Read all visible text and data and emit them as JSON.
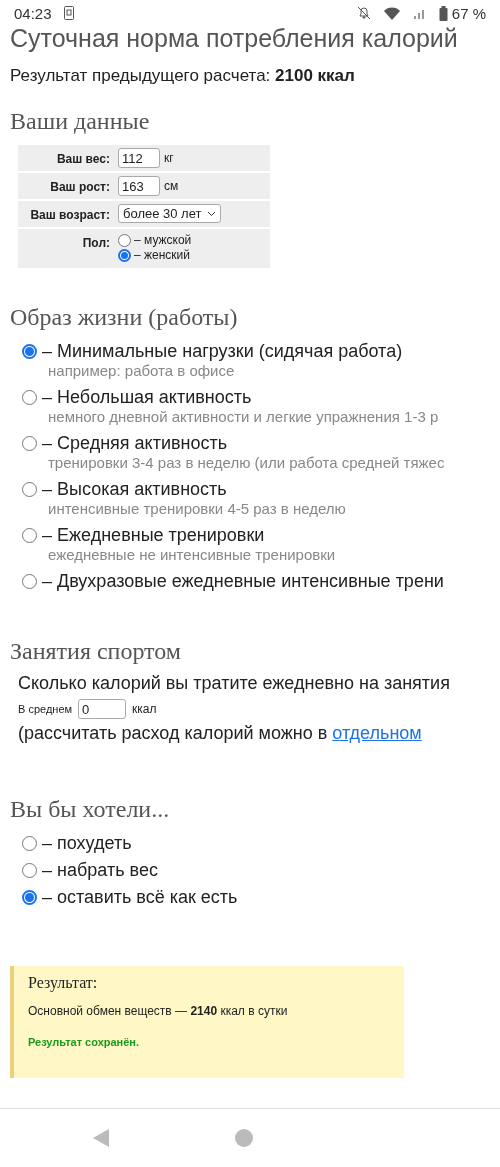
{
  "status_bar": {
    "time": "04:23",
    "battery": "67 %"
  },
  "title": "Суточная норма потребления калорий",
  "previous_result": "Результат предыдущего расчета: **2100 ккал**",
  "your_data": {
    "heading": "Ваши данные",
    "fields": [
      {
        "kind": "input",
        "label": "Ваш вес:",
        "value": "112",
        "unit": "кг"
      },
      {
        "kind": "input",
        "label": "Ваш рост:",
        "value": "163",
        "unit": "см"
      },
      {
        "kind": "select",
        "label": "Ваш возраст:",
        "value": "более 30 лет"
      },
      {
        "kind": "radio",
        "label": "Пол:",
        "options": [
          {
            "label": "– мужской",
            "selected": false
          },
          {
            "label": "– женский",
            "selected": true
          }
        ]
      }
    ]
  },
  "lifestyle": {
    "heading": "Образ жизни (работы)",
    "options": [
      {
        "label": "– Минимальные нагрузки (сидячая работа)",
        "note": "например: работа в офисе",
        "selected": true
      },
      {
        "label": "– Небольшая активность",
        "note": "немного дневной активности и легкие упражнения 1-3 р",
        "selected": false
      },
      {
        "label": "– Средняя активность",
        "note": "тренировки 3-4 раз в неделю (или работа средней тяжес",
        "selected": false
      },
      {
        "label": "– Высокая активность",
        "note": "интенсивные тренировки 4-5 раз в неделю",
        "selected": false
      },
      {
        "label": "– Ежедневные тренировки",
        "note": "ежедневные не интенсивные тренировки",
        "selected": false
      },
      {
        "label": "– Двухразовые ежедневные интенсивные трени",
        "selected": false
      }
    ]
  },
  "sport": {
    "heading": "Занятия спортом",
    "question": "Сколько калорий вы тратите ежедневно на занятия",
    "average": {
      "label": "В среднем",
      "value": "0",
      "unit": "ккал"
    },
    "note": "(рассчитать расход калорий можно в",
    "link": "отдельном"
  },
  "goal": {
    "heading": "Вы бы хотели...",
    "options": [
      {
        "label": "– похудеть",
        "selected": false
      },
      {
        "label": "– набрать вес",
        "selected": false
      },
      {
        "label": "– оставить всё как есть",
        "selected": true
      }
    ]
  },
  "result": {
    "heading": "Результат:",
    "text": "Основной обмен веществ — **2140** ккал в сутки",
    "saved": "Результат сохранён."
  }
}
